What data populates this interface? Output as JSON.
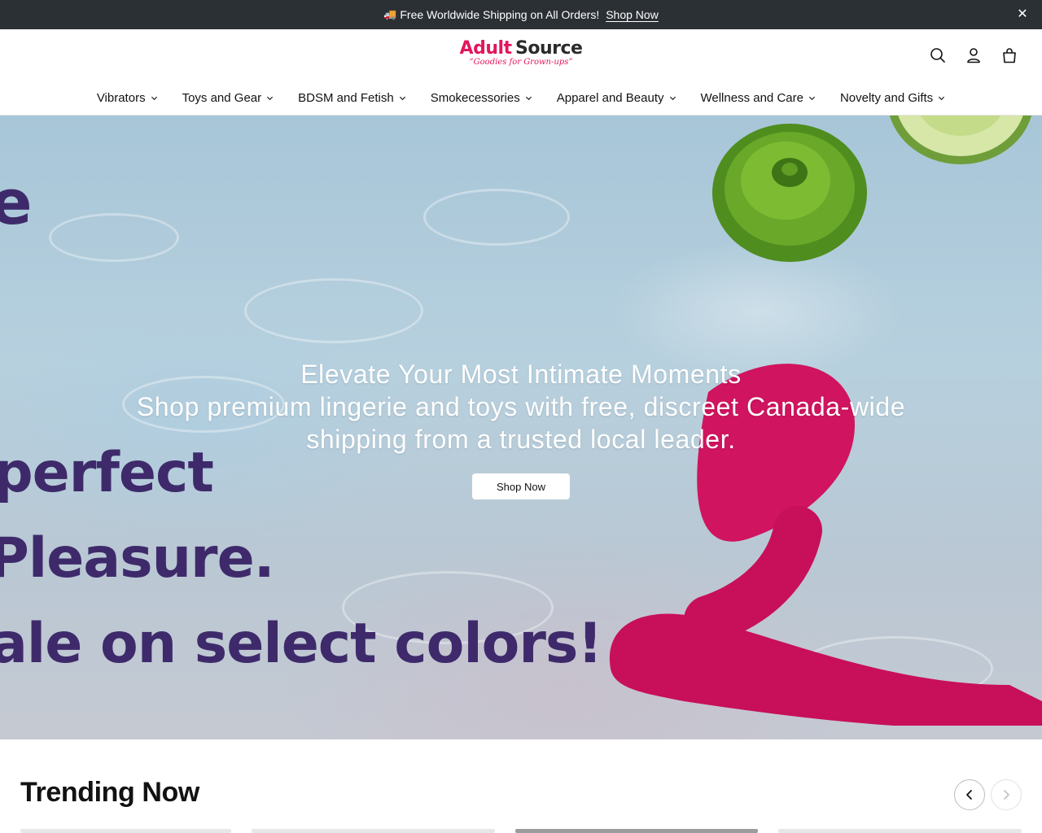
{
  "announcement": {
    "icon": "truck-icon",
    "truck_glyph": "🚚",
    "message": "Free Worldwide Shipping on All Orders!",
    "link": "Shop Now",
    "close_glyph": "✕"
  },
  "logo": {
    "word1": "Adult",
    "word2": "Source",
    "tagline": "“Goodies for Grown-ups”"
  },
  "header_icons": [
    "search-icon",
    "account-icon",
    "cart-icon"
  ],
  "nav": {
    "items": [
      {
        "label": "Vibrators"
      },
      {
        "label": "Toys and Gear"
      },
      {
        "label": "BDSM and Fetish"
      },
      {
        "label": "Smokecessories"
      },
      {
        "label": "Apparel and Beauty"
      },
      {
        "label": "Wellness and Care"
      },
      {
        "label": "Novelty and Gifts"
      }
    ]
  },
  "hero": {
    "title": "Elevate Your Most Intimate Moments",
    "subtitle": "Shop premium lingerie and toys with free, discreet Canada-wide shipping from a trusted local leader.",
    "button": "Shop Now",
    "image_text": {
      "line1": "e",
      "line2": "perfect",
      "line3": "Pleasure.",
      "line4": "ale on select colors!"
    }
  },
  "trending": {
    "title": "Trending Now",
    "prev_icon": "chevron-left-icon",
    "next_icon": "chevron-right-icon"
  },
  "colors": {
    "announcement_bg": "#2b3035",
    "brand_pink": "#e3155d",
    "promo_text": "#3e2a6b"
  }
}
